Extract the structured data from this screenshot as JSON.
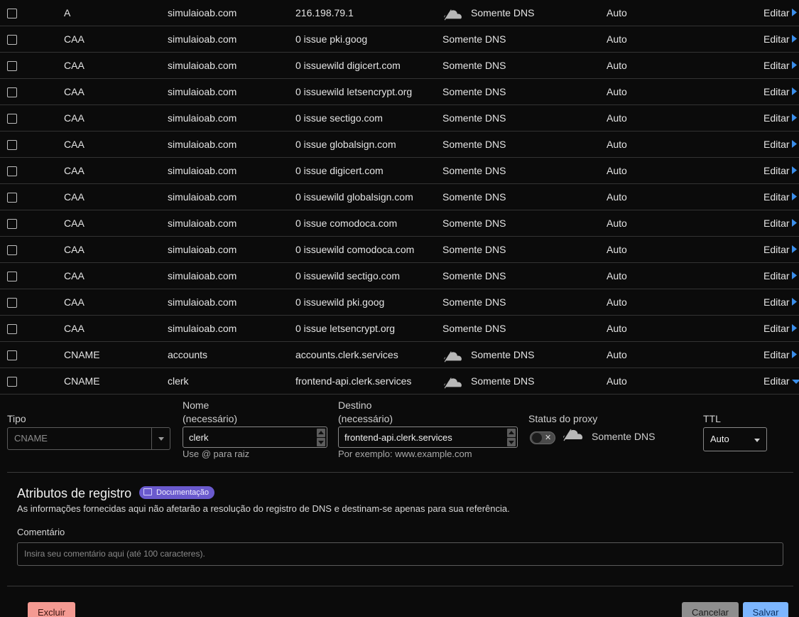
{
  "records": [
    {
      "type": "A",
      "name": "simulaioab.com",
      "content": "216.198.79.1",
      "proxy_icon": "cloud-icon",
      "proxy": "Somente DNS",
      "ttl": "Auto",
      "edit": "Editar"
    },
    {
      "type": "CAA",
      "name": "simulaioab.com",
      "content": "0 issue pki.goog",
      "proxy": "Somente DNS",
      "ttl": "Auto",
      "edit": "Editar"
    },
    {
      "type": "CAA",
      "name": "simulaioab.com",
      "content": "0 issuewild digicert.com",
      "proxy": "Somente DNS",
      "ttl": "Auto",
      "edit": "Editar"
    },
    {
      "type": "CAA",
      "name": "simulaioab.com",
      "content": "0 issuewild letsencrypt.org",
      "proxy": "Somente DNS",
      "ttl": "Auto",
      "edit": "Editar"
    },
    {
      "type": "CAA",
      "name": "simulaioab.com",
      "content": "0 issue sectigo.com",
      "proxy": "Somente DNS",
      "ttl": "Auto",
      "edit": "Editar"
    },
    {
      "type": "CAA",
      "name": "simulaioab.com",
      "content": "0 issue globalsign.com",
      "proxy": "Somente DNS",
      "ttl": "Auto",
      "edit": "Editar"
    },
    {
      "type": "CAA",
      "name": "simulaioab.com",
      "content": "0 issue digicert.com",
      "proxy": "Somente DNS",
      "ttl": "Auto",
      "edit": "Editar"
    },
    {
      "type": "CAA",
      "name": "simulaioab.com",
      "content": "0 issuewild globalsign.com",
      "proxy": "Somente DNS",
      "ttl": "Auto",
      "edit": "Editar"
    },
    {
      "type": "CAA",
      "name": "simulaioab.com",
      "content": "0 issue comodoca.com",
      "proxy": "Somente DNS",
      "ttl": "Auto",
      "edit": "Editar"
    },
    {
      "type": "CAA",
      "name": "simulaioab.com",
      "content": "0 issuewild comodoca.com",
      "proxy": "Somente DNS",
      "ttl": "Auto",
      "edit": "Editar"
    },
    {
      "type": "CAA",
      "name": "simulaioab.com",
      "content": "0 issuewild sectigo.com",
      "proxy": "Somente DNS",
      "ttl": "Auto",
      "edit": "Editar"
    },
    {
      "type": "CAA",
      "name": "simulaioab.com",
      "content": "0 issuewild pki.goog",
      "proxy": "Somente DNS",
      "ttl": "Auto",
      "edit": "Editar"
    },
    {
      "type": "CAA",
      "name": "simulaioab.com",
      "content": "0 issue letsencrypt.org",
      "proxy": "Somente DNS",
      "ttl": "Auto",
      "edit": "Editar"
    },
    {
      "type": "CNAME",
      "name": "accounts",
      "content": "accounts.clerk.services",
      "proxy_icon": "cloud-icon",
      "proxy": "Somente DNS",
      "ttl": "Auto",
      "edit": "Editar"
    },
    {
      "type": "CNAME",
      "name": "clerk",
      "content": "frontend-api.clerk.services",
      "proxy_icon": "cloud-icon",
      "proxy": "Somente DNS",
      "ttl": "Auto",
      "edit": "Editar",
      "expanded": true
    }
  ],
  "form": {
    "type_label": "Tipo",
    "type_value": "CNAME",
    "name_label_line1": "Nome",
    "name_label_line2": "(necessário)",
    "name_value": "clerk",
    "name_help": "Use @ para raiz",
    "target_label_line1": "Destino",
    "target_label_line2": "(necessário)",
    "target_value": "frontend-api.clerk.services",
    "target_help": "Por exemplo: www.example.com",
    "proxy_label": "Status do proxy",
    "proxy_toggle_mark": "✕",
    "proxy_value": "Somente DNS",
    "ttl_label": "TTL",
    "ttl_value": "Auto"
  },
  "attributes": {
    "title": "Atributos de registro",
    "doc_badge": "Documentação",
    "description": "As informações fornecidas aqui não afetarão a resolução do registro de DNS e destinam-se apenas para sua referência.",
    "comment_label": "Comentário",
    "comment_placeholder": "Insira seu comentário aqui (até 100 caracteres)."
  },
  "buttons": {
    "delete": "Excluir",
    "cancel": "Cancelar",
    "save": "Salvar"
  },
  "colors": {
    "background": "#0b0b0b",
    "link": "#3b8eea",
    "badge": "#6a5acd",
    "delete": "#f49a92",
    "cancel": "#8e8e8e",
    "save": "#7cb6ff"
  }
}
